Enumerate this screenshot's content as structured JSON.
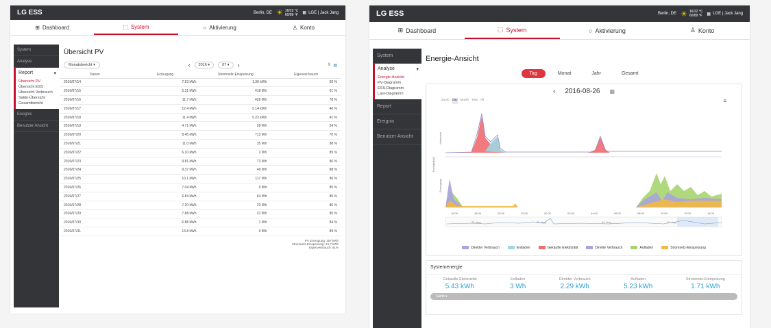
{
  "left": {
    "brand": "LG ESS",
    "location": "Berlin, DE",
    "temp": "16/22 ℃\n60/89 ℉",
    "user": "LGE | Jack Jang",
    "nav": [
      "Dashboard",
      "System",
      "Aktivierung",
      "Konto"
    ],
    "sidebar": {
      "system": "System",
      "analyse": "Analyse",
      "report": "Report",
      "sub": [
        "Übersicht PV",
        "Übersicht ESS",
        "Übersicht Verbrauch",
        "Saldo-Übersicht",
        "Gesamtbericht"
      ],
      "ereignis": "Ereignis",
      "benutzer": "Benutzer Ansicht"
    },
    "title": "Übersicht PV",
    "report_select": "Monatsbericht",
    "year": "2016",
    "month": "07",
    "columns": [
      "Datum",
      "Erzeugung",
      "Stromnetz-Einspeisung",
      "Eigenverbrauch"
    ],
    "rows": [
      [
        "2016/07/14",
        "7.53 kWh",
        "1.36 kWh",
        "69 %"
      ],
      [
        "2016/07/15",
        "5.31 kWh",
        "418 Wh",
        "61 %"
      ],
      [
        "2016/07/16",
        "11.7 kWh",
        "426 Wh",
        "78 %"
      ],
      [
        "2016/07/17",
        "12.4 kWh",
        "5.14 kWh",
        "40 %"
      ],
      [
        "2016/07/18",
        "11.4 kWh",
        "5.22 kWh",
        "41 %"
      ],
      [
        "2016/07/19",
        "4.71 kWh",
        "28 Wh",
        "54 %"
      ],
      [
        "2016/07/20",
        "8.45 kWh",
        "713 Wh",
        "70 %"
      ],
      [
        "2016/07/21",
        "11.0 kWh",
        "35 Wh",
        "88 %"
      ],
      [
        "2016/07/22",
        "6.10 kWh",
        "2 Wh",
        "85 %"
      ],
      [
        "2016/07/23",
        "9.81 kWh",
        "73 Wh",
        "86 %"
      ],
      [
        "2016/07/24",
        "9.37 kWh",
        "49 Wh",
        "88 %"
      ],
      [
        "2016/07/25",
        "10.1 kWh",
        "117 Wh",
        "86 %"
      ],
      [
        "2016/07/26",
        "7.04 kWh",
        "0 Wh",
        "85 %"
      ],
      [
        "2016/07/27",
        "6.84 kWh",
        "64 Wh",
        "85 %"
      ],
      [
        "2016/07/28",
        "7.20 kWh",
        "33 Wh",
        "86 %"
      ],
      [
        "2016/07/29",
        "7.88 kWh",
        "31 Wh",
        "85 %"
      ],
      [
        "2016/07/30",
        "6.88 kWh",
        "1 Wh",
        "84 %"
      ],
      [
        "2016/07/31",
        "13.8 kWh",
        "0 Wh",
        "89 %"
      ]
    ],
    "summary": [
      "PV Erzeugung: 157 kWh",
      "Stromnetz-Einspeisung: 13.7 kWh",
      "Eigenverbrauch: 91%"
    ]
  },
  "right": {
    "brand": "LG ESS",
    "location": "Berlin, DE",
    "temp": "16/22 ℃\n60/89 ℉",
    "user": "LGE | Jack Jang",
    "nav": [
      "Dashboard",
      "System",
      "Aktivierung",
      "Konto"
    ],
    "sidebar": {
      "system": "System",
      "analyse": "Analyse",
      "sub": [
        "Energie-Ansicht",
        "PV-Diagramm",
        "ESS-Diagramm",
        "Last-Diagramm"
      ],
      "report": "Report",
      "ereignis": "Ereignis",
      "benutzer": "Benutzer Ansicht"
    },
    "title": "Energie-Ansicht",
    "tabs": [
      "Tag",
      "Monat",
      "Jahr",
      "Gesamt"
    ],
    "date": "2016-08-26",
    "zoom": [
      "Zoom",
      "Day",
      "Month",
      "Year",
      "All"
    ],
    "xticks": [
      "16:00",
      "18:00",
      "20:00",
      "22:00",
      "00:00",
      "02:00",
      "04:00",
      "06:00",
      "08:00",
      "10:00",
      "12:00",
      "14:00"
    ],
    "nav_labels": [
      "20. Aug",
      "22. Aug",
      "24. Aug",
      "26. Aug"
    ],
    "ylab_top": "Verbrauch",
    "ylab_bottom": "Erzeugung",
    "ylab_side": "Energie[kW]",
    "legend": [
      {
        "name": "Direkter Verbrauch",
        "color": "#a9a6d8"
      },
      {
        "name": "Entladen",
        "color": "#9ed7e0"
      },
      {
        "name": "Gekaufte Elektrizität",
        "color": "#ef6c70"
      },
      {
        "name": "Direkte Verbrauch",
        "color": "#a9a6d8"
      },
      {
        "name": "Aufladen",
        "color": "#a7d46f"
      },
      {
        "name": "Stromnetz-Einspeisung",
        "color": "#f2b842"
      }
    ],
    "system_label": "Systemenergie",
    "stats": [
      {
        "label": "Gekaufte Elektrizität",
        "value": "5.43 kWh"
      },
      {
        "label": "Entladen",
        "value": "3 Wh"
      },
      {
        "label": "Direkter Verbrauch",
        "value": "2.29 kWh"
      },
      {
        "label": "Aufladen",
        "value": "5.23 kWh"
      },
      {
        "label": "Stromnetz-Einspeisung",
        "value": "1.71 kWh"
      }
    ],
    "saldo": "Saldo"
  }
}
